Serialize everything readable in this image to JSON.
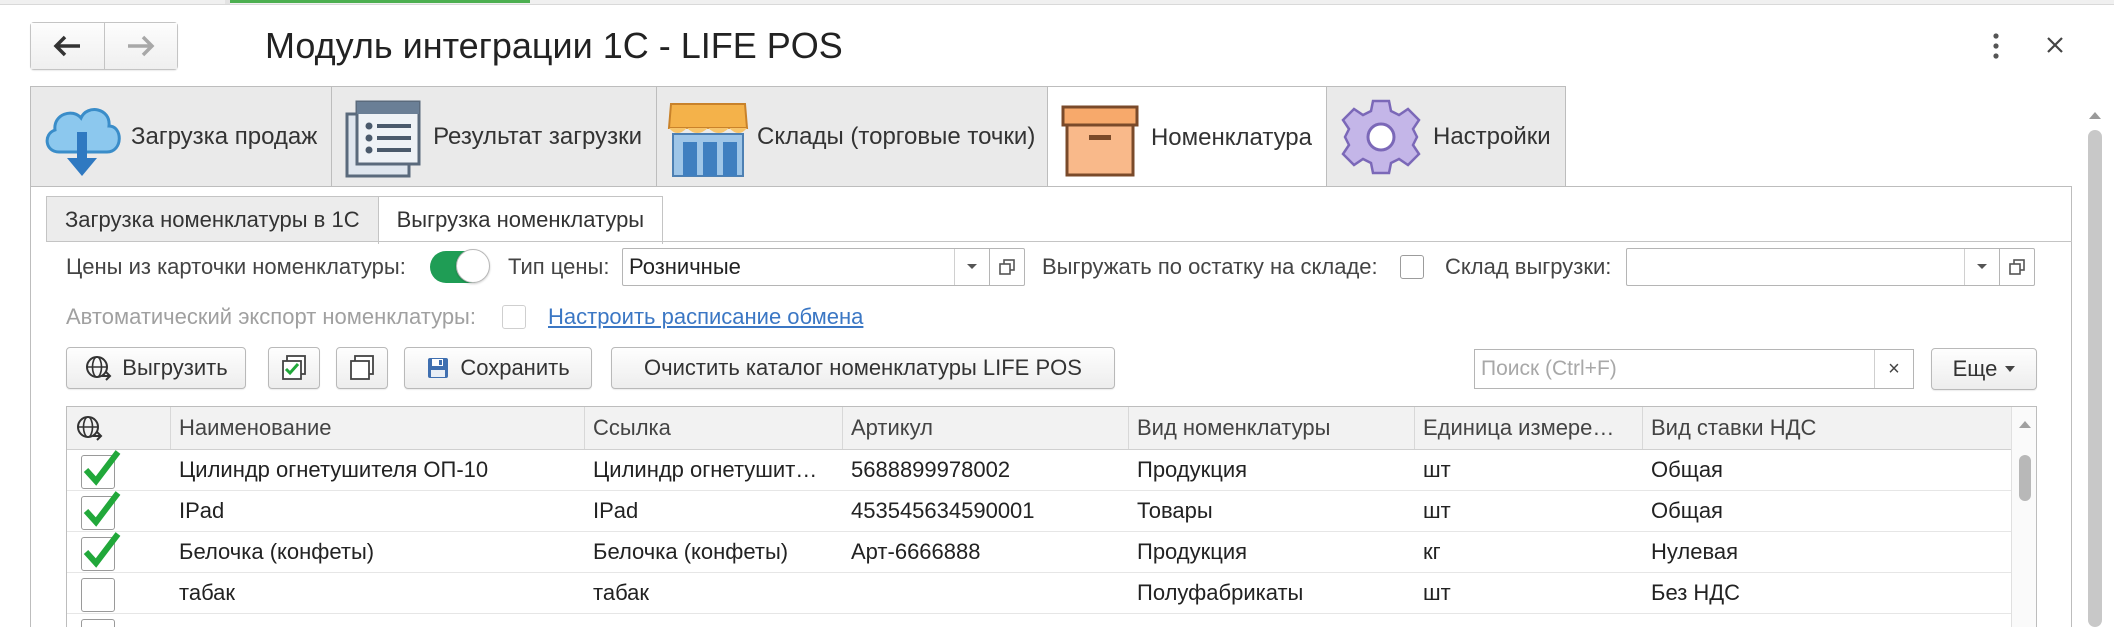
{
  "window": {
    "title": "Модуль интеграции 1С - LIFE POS"
  },
  "tabs": [
    {
      "label": "Загрузка продаж",
      "icon": "cloud-download-icon"
    },
    {
      "label": "Результат загрузки",
      "icon": "list-document-icon"
    },
    {
      "label": "Склады (торговые точки)",
      "icon": "store-icon"
    },
    {
      "label": "Номенклатура",
      "icon": "archive-box-icon"
    },
    {
      "label": "Настройки",
      "icon": "gear-icon"
    }
  ],
  "subtabs": [
    {
      "label": "Загрузка номенклатуры в 1С"
    },
    {
      "label": "Выгрузка номенклатуры"
    }
  ],
  "form": {
    "prices_label": "Цены из карточки номенклатуры:",
    "prices_toggle": "on",
    "price_type_label": "Тип цены:",
    "price_type_value": "Розничные",
    "by_stock_label": "Выгружать по остатку на складе:",
    "warehouse_label": "Склад выгрузки:",
    "warehouse_value": "",
    "auto_export_label": "Автоматический экспорт номенклатуры:",
    "schedule_link": "Настроить расписание обмена"
  },
  "toolbar": {
    "export_label": "Выгрузить",
    "save_label": "Сохранить",
    "clear_label": "Очистить каталог номенклатуры LIFE POS",
    "search_placeholder": "Поиск (Ctrl+F)",
    "search_clear": "×",
    "more_label": "Еще"
  },
  "table": {
    "columns": [
      "Наименование",
      "Ссылка",
      "Артикул",
      "Вид номенклатуры",
      "Единица измере…",
      "Вид ставки НДС"
    ],
    "rows": [
      {
        "checked": true,
        "name": "Цилиндр огнетушителя ОП-10",
        "ref": "Цилиндр огнетушит…",
        "sku": "5688899978002",
        "kind": "Продукция",
        "unit": "шт",
        "vat": "Общая"
      },
      {
        "checked": true,
        "name": "IPad",
        "ref": "IPad",
        "sku": "453545634590001",
        "kind": "Товары",
        "unit": "шт",
        "vat": "Общая"
      },
      {
        "checked": true,
        "name": "Белочка (конфеты)",
        "ref": "Белочка (конфеты)",
        "sku": "Арт-6666888",
        "kind": "Продукция",
        "unit": "кг",
        "vat": "Нулевая"
      },
      {
        "checked": false,
        "name": "табак",
        "ref": "табак",
        "sku": "",
        "kind": "Полуфабрикаты",
        "unit": "шт",
        "vat": "Без НДС"
      },
      {
        "checked": false,
        "name": "",
        "ref": "",
        "sku": "",
        "kind": "",
        "unit": "",
        "vat": ""
      }
    ]
  },
  "colors": {
    "accent_green": "#1f9d55",
    "check_green": "#21a83a",
    "link_blue": "#3b77c4"
  }
}
